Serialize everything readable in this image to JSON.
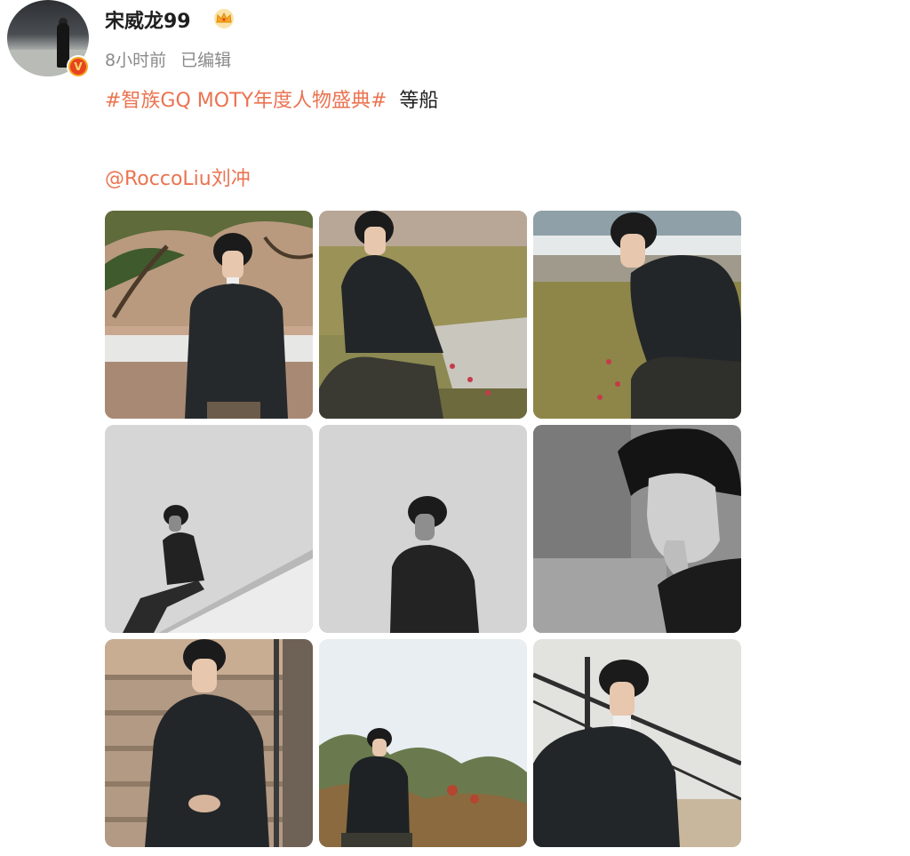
{
  "post": {
    "username": "宋威龙99",
    "badge_letter": "V",
    "time": "8小时前",
    "edited": "已编辑",
    "topic": "#智族GQ MOTY年度人物盛典#",
    "text": "等船",
    "mention": "@RoccoLiu刘冲"
  },
  "icons": {
    "avatar": "avatar-photo",
    "verified": "verified-v-icon",
    "member": "crown-icon"
  },
  "colors": {
    "link_orange": "#eb7350",
    "meta_gray": "#8a8a8a",
    "verified_red": "#e8431d",
    "crown_gold": "#f5a623"
  },
  "photos": [
    {
      "scene": "color-tree-standing"
    },
    {
      "scene": "color-sitting-rock"
    },
    {
      "scene": "color-thinking-flowers"
    },
    {
      "scene": "bw-sitting-wall"
    },
    {
      "scene": "bw-looking-up"
    },
    {
      "scene": "bw-closeup"
    },
    {
      "scene": "color-stairs-sitting"
    },
    {
      "scene": "color-sky-hill"
    },
    {
      "scene": "color-railing"
    }
  ]
}
